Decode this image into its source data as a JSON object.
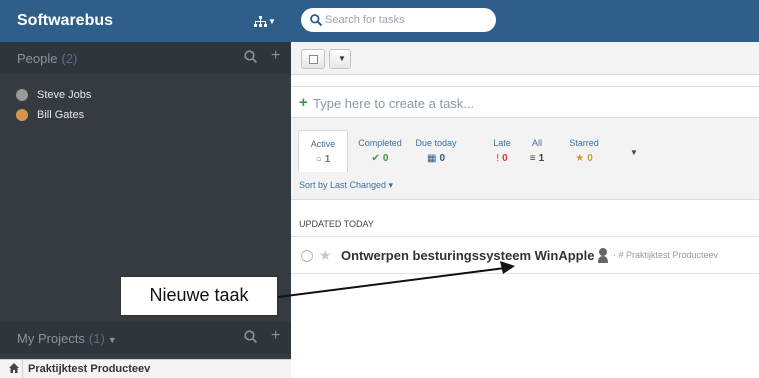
{
  "app": {
    "title": "Softwarebus"
  },
  "search": {
    "placeholder": "Search for tasks"
  },
  "people": {
    "title": "People",
    "count": "(2)",
    "items": [
      {
        "name": "Steve Jobs",
        "avatar": "steve-jobs-avatar"
      },
      {
        "name": "Bill Gates",
        "avatar": "bill-gates-avatar"
      }
    ]
  },
  "projects": {
    "title": "My Projects",
    "count": "(1)",
    "items": [
      {
        "name": "Praktijktest Producteev"
      }
    ]
  },
  "create": {
    "placeholder": "Type here to create a task..."
  },
  "filters": [
    {
      "label": "Active",
      "icon": "○",
      "count": "1",
      "color": "#444444"
    },
    {
      "label": "Completed",
      "icon": "✔",
      "count": "0",
      "color": "#3a9d3a"
    },
    {
      "label": "Due today",
      "icon": "▦",
      "count": "0",
      "color": "#2e5e8a"
    },
    {
      "label": "Late",
      "icon": "!",
      "count": "0",
      "color": "#dd3333"
    },
    {
      "label": "All",
      "icon": "≡",
      "count": "1",
      "color": "#444444"
    },
    {
      "label": "Starred",
      "icon": "★",
      "count": "0",
      "color": "#d0a030"
    }
  ],
  "sort": {
    "label": "Sort by Last Changed ▾"
  },
  "section": {
    "label": "UPDATED TODAY"
  },
  "task": {
    "title": "Ontwerpen besturingssysteem WinApple",
    "project": "· # Praktijktest Producteev"
  },
  "annotation": {
    "text": "Nieuwe taak"
  },
  "colors": {
    "header": "#2e5e8a",
    "sidebar": "#363b41",
    "accent_green": "#3a9d3a"
  }
}
